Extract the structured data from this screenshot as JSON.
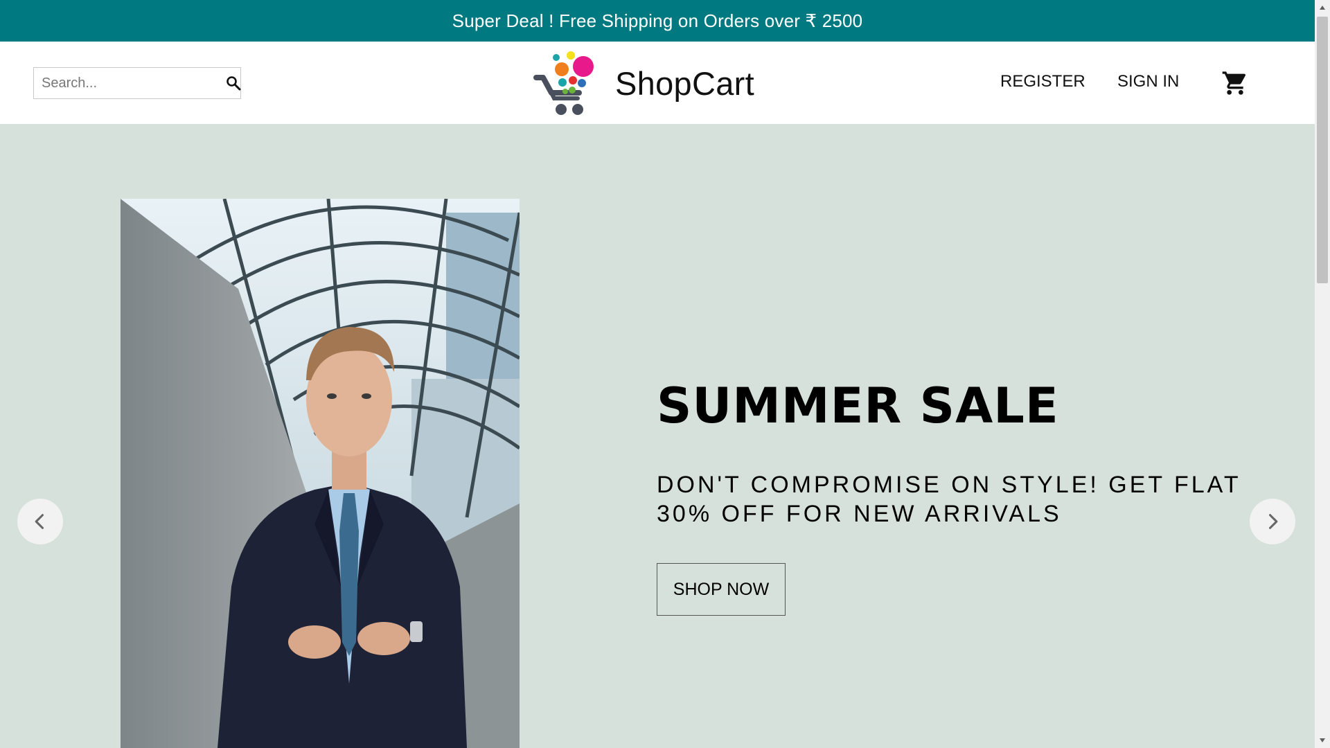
{
  "announcement": {
    "text": "Super Deal ! Free Shipping on Orders over ₹ 2500"
  },
  "header": {
    "search": {
      "placeholder": "Search...",
      "value": ""
    },
    "brand_name": "ShopCart",
    "nav": {
      "register": "REGISTER",
      "sign_in": "SIGN IN"
    },
    "icons": [
      "search-icon",
      "shopcart-logo",
      "shopping-cart-icon"
    ]
  },
  "hero": {
    "title": "SUMMER SALE",
    "subtitle": "DON'T COMPROMISE ON STYLE! GET FLAT 30% OFF FOR NEW ARRIVALS",
    "cta_label": "SHOP NOW",
    "controls": [
      "chevron-left-icon",
      "chevron-right-icon"
    ]
  },
  "colors": {
    "announcement_bg": "#007a80",
    "hero_bg": "#d7e1db",
    "logo_pink": "#e8198b",
    "logo_orange": "#f07e1c",
    "logo_yellow": "#f7e017",
    "logo_teal": "#1aa3a8",
    "logo_green": "#6bb33a",
    "logo_red": "#e4312f",
    "logo_blue": "#2e6fb7",
    "logo_gray": "#4a4f5e"
  }
}
